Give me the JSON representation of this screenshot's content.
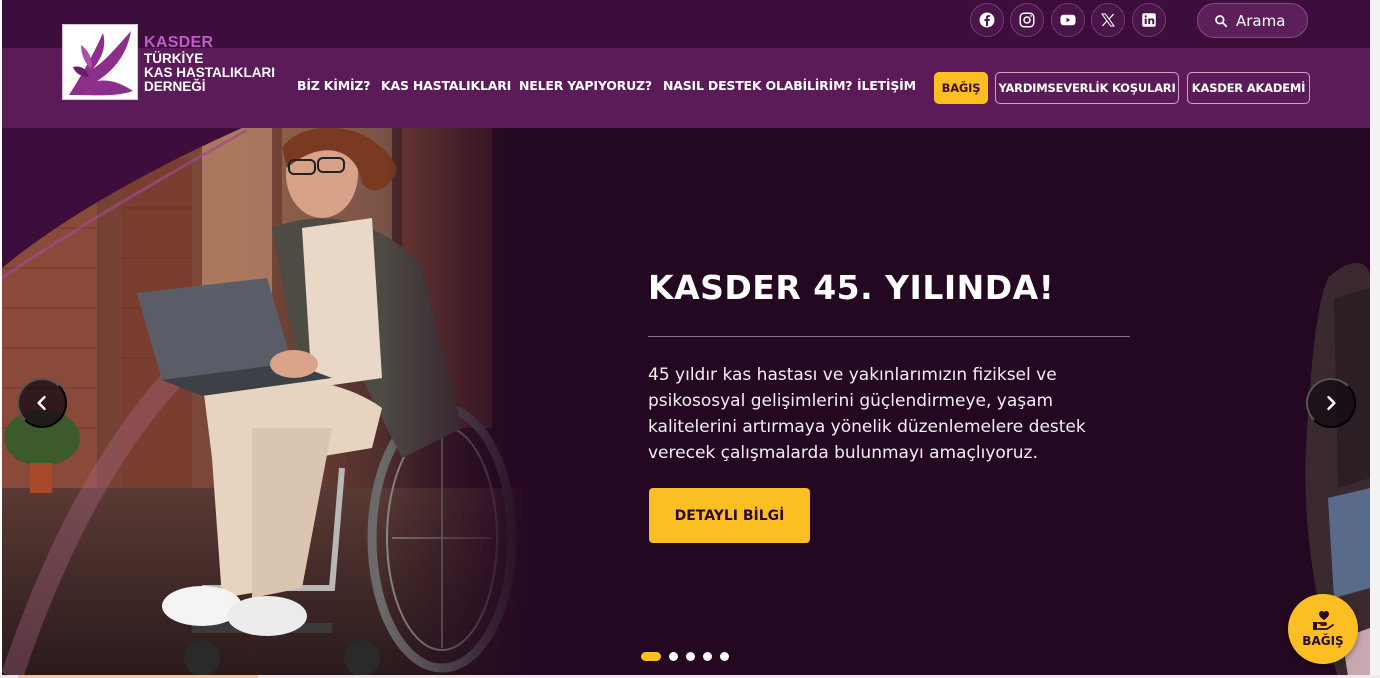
{
  "brand": {
    "short": "KASDER",
    "line1": "TÜRKİYE",
    "line2": "KAS HASTALIKLARI",
    "line3": "DERNEĞİ"
  },
  "colors": {
    "primary": "#4a1348",
    "accent": "#fbbf24",
    "hero_bg": "#240821"
  },
  "social": [
    {
      "name": "facebook-icon"
    },
    {
      "name": "instagram-icon"
    },
    {
      "name": "youtube-icon"
    },
    {
      "name": "x-icon"
    },
    {
      "name": "linkedin-icon"
    }
  ],
  "search": {
    "label": "Arama",
    "icon": "search-icon"
  },
  "nav": {
    "items": [
      "BİZ KİMİZ?",
      "KAS HASTALIKLARI",
      "NELER YAPIYORUZ?",
      "NASIL DESTEK OLABİLİRİM?",
      "İLETİŞİM"
    ],
    "donate": "BAĞIŞ",
    "charity_runs": "YARDIMSEVERLİK KOŞULARI",
    "academy": "KASDER AKADEMİ"
  },
  "hero": {
    "title": "KASDER 45. YILINDA!",
    "description": "45 yıldır kas hastası ve yakınlarımızın fiziksel ve psikososyal gelişimlerini güçlendirmeye, yaşam kalitelerini artırmaya yönelik düzenlemelere destek verecek çalışmalarda bulunmayı amaçlıyoruz.",
    "cta": "DETAYLI BİLGİ",
    "slide_count": 5,
    "active_slide": 1
  },
  "floating_donate": {
    "label": "BAĞIŞ",
    "icon": "donate-hand-heart-icon"
  }
}
